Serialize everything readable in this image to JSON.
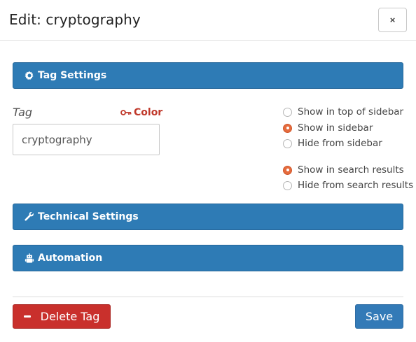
{
  "dialog": {
    "title": "Edit: cryptography",
    "close_label": "×"
  },
  "sections": {
    "tag_settings": {
      "label": "Tag Settings",
      "icon": "gear-icon"
    },
    "technical_settings": {
      "label": "Technical Settings",
      "icon": "wrench-icon"
    },
    "automation": {
      "label": "Automation",
      "icon": "robot-icon"
    }
  },
  "tag_field": {
    "label": "Tag",
    "value": "cryptography",
    "color_link": {
      "label": "Color",
      "icon": "key-icon"
    }
  },
  "sidebar_options": [
    {
      "label": "Show in top of sidebar",
      "checked": false
    },
    {
      "label": "Show in sidebar",
      "checked": true
    },
    {
      "label": "Hide from sidebar",
      "checked": false
    }
  ],
  "search_options": [
    {
      "label": "Show in search results",
      "checked": true
    },
    {
      "label": "Hide from search results",
      "checked": false
    }
  ],
  "footer": {
    "delete_label": "Delete Tag",
    "save_label": "Save"
  },
  "colors": {
    "section_bar": "#2e7bb5",
    "delete": "#c9302c",
    "save": "#337ab7",
    "radio_checked": "#e56b3d",
    "color_link": "#c0392b"
  }
}
